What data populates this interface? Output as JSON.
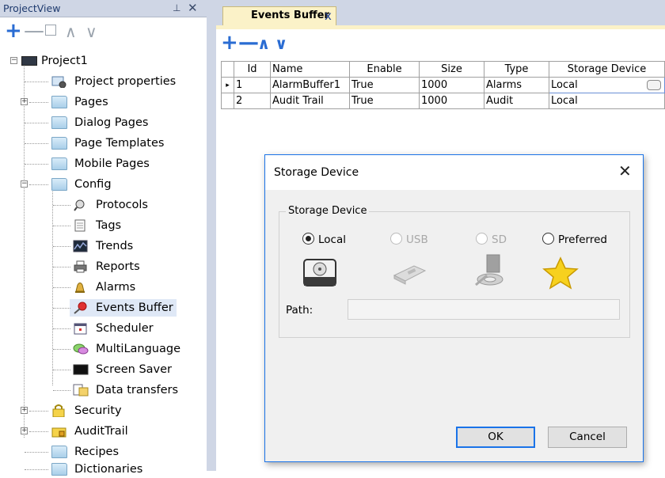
{
  "project_view": {
    "title": "ProjectView",
    "pin_glyph": "⊥",
    "close_glyph": "✕",
    "toolbar": {
      "add": "+",
      "remove": "—",
      "up": "∧",
      "down": "∨"
    },
    "root_label": "Project1",
    "items": [
      {
        "label": "Project properties",
        "icon": "gear-page-icon"
      },
      {
        "label": "Pages",
        "icon": "folder-icon"
      },
      {
        "label": "Dialog Pages",
        "icon": "folder-icon"
      },
      {
        "label": "Page Templates",
        "icon": "folder-icon"
      },
      {
        "label": "Mobile Pages",
        "icon": "folder-icon"
      },
      {
        "label": "Config",
        "icon": "folder-open-icon"
      },
      {
        "label": "Protocols",
        "icon": "protocol-icon"
      },
      {
        "label": "Tags",
        "icon": "tags-icon"
      },
      {
        "label": "Trends",
        "icon": "trends-icon"
      },
      {
        "label": "Reports",
        "icon": "printer-icon"
      },
      {
        "label": "Alarms",
        "icon": "alarm-bell-icon"
      },
      {
        "label": "Events Buffer",
        "icon": "pushpin-icon"
      },
      {
        "label": "Scheduler",
        "icon": "calendar-icon"
      },
      {
        "label": "MultiLanguage",
        "icon": "speech-bubble-icon"
      },
      {
        "label": "Screen Saver",
        "icon": "monitor-icon"
      },
      {
        "label": "Data transfers",
        "icon": "data-transfer-icon"
      },
      {
        "label": "Security",
        "icon": "lock-folder-icon"
      },
      {
        "label": "AuditTrail",
        "icon": "lock-folder-icon"
      },
      {
        "label": "Recipes",
        "icon": "folder-icon"
      },
      {
        "label": "Dictionaries",
        "icon": "folder-icon"
      }
    ]
  },
  "editor": {
    "tab_label": "Events Buffer",
    "tab_close": "x",
    "toolbar": {
      "add": "+",
      "remove": "—",
      "up": "∧",
      "down": "∨"
    },
    "columns": [
      "Id",
      "Name",
      "Enable",
      "Size",
      "Type",
      "Storage Device"
    ],
    "rows": [
      {
        "id": "1",
        "name": "AlarmBuffer1",
        "enable": "True",
        "size": "1000",
        "type": "Alarms",
        "storage": "Local"
      },
      {
        "id": "2",
        "name": "Audit Trail",
        "enable": "True",
        "size": "1000",
        "type": "Audit",
        "storage": "Local"
      }
    ]
  },
  "dialog": {
    "title": "Storage Device",
    "close": "✕",
    "group_label": "Storage Device",
    "options": [
      {
        "label": "Local",
        "selected": true,
        "enabled": true
      },
      {
        "label": "USB",
        "selected": false,
        "enabled": false
      },
      {
        "label": "SD",
        "selected": false,
        "enabled": false
      },
      {
        "label": "Preferred",
        "selected": false,
        "enabled": true
      }
    ],
    "path_label": "Path:",
    "path_value": "",
    "ok_label": "OK",
    "cancel_label": "Cancel"
  },
  "colors": {
    "accent": "#2a6cd3",
    "tab_bg": "#fbf2c8",
    "frame": "#cfd6e5",
    "dialog_border": "#1a73e8"
  }
}
